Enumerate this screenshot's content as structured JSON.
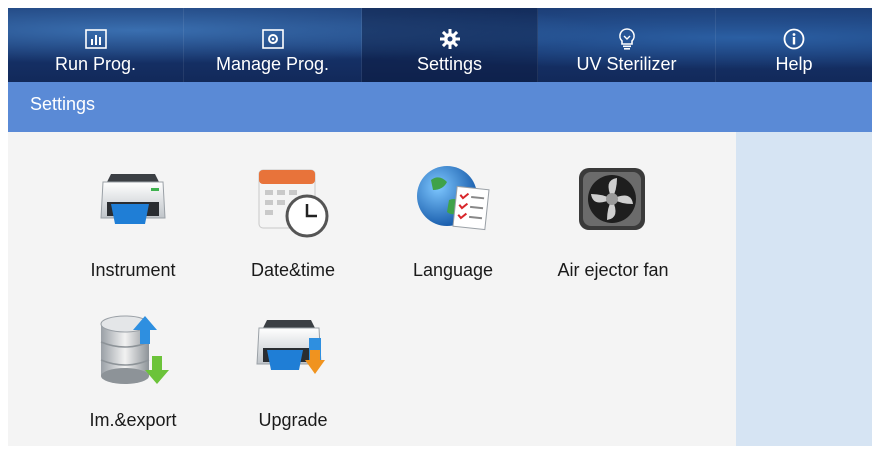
{
  "nav": {
    "tabs": [
      {
        "label": "Run Prog.",
        "icon": "bar-chart-icon",
        "active": false
      },
      {
        "label": "Manage Prog.",
        "icon": "gear-box-icon",
        "active": false
      },
      {
        "label": "Settings",
        "icon": "gear-icon",
        "active": true
      },
      {
        "label": "UV Sterilizer",
        "icon": "bulb-icon",
        "active": false
      },
      {
        "label": "Help",
        "icon": "info-icon",
        "active": false
      }
    ]
  },
  "header": {
    "title": "Settings"
  },
  "tiles": [
    {
      "label": "Instrument",
      "icon": "printer-icon"
    },
    {
      "label": "Date&time",
      "icon": "calendar-clock-icon"
    },
    {
      "label": "Language",
      "icon": "globe-document-icon"
    },
    {
      "label": "Air ejector fan",
      "icon": "fan-icon"
    },
    {
      "label": "Im.&export",
      "icon": "database-transfer-icon"
    },
    {
      "label": "Upgrade",
      "icon": "printer-upgrade-icon"
    }
  ],
  "colors": {
    "nav_bg": "#16336a",
    "header_bg": "#5a8ad6",
    "side_panel": "#d6e4f3"
  }
}
